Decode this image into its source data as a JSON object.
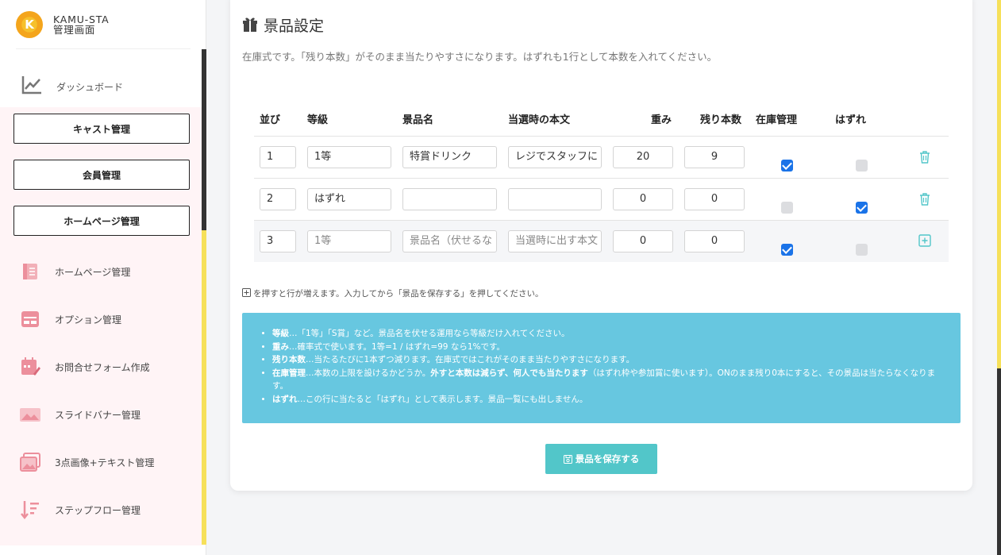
{
  "brand": {
    "line1": "KAMU-STA",
    "line2": "管理画面",
    "logo": "K"
  },
  "sidebar": {
    "dashboard": "ダッシュボード",
    "buttons": [
      "キャスト管理",
      "会員管理",
      "ホームページ管理"
    ],
    "sub_items": [
      {
        "label": "ホームページ管理",
        "icon": "book-icon"
      },
      {
        "label": "オプション管理",
        "icon": "option-list-icon"
      },
      {
        "label": "お問合せフォーム作成",
        "icon": "calendar-edit-icon"
      },
      {
        "label": "スライドバナー管理",
        "icon": "image-banner-icon"
      },
      {
        "label": "3点画像+テキスト管理",
        "icon": "images-icon"
      },
      {
        "label": "ステップフロー管理",
        "icon": "sort-flow-icon"
      }
    ]
  },
  "page": {
    "title": "景品設定",
    "description": "在庫式です。「残り本数」がそのまま当たりやすさになります。はずれも1行として本数を入れてください。"
  },
  "table": {
    "headers": [
      "並び",
      "等級",
      "景品名",
      "当選時の本文",
      "重み",
      "残り本数",
      "在庫管理",
      "はずれ"
    ],
    "rows": [
      {
        "order": "1",
        "grade": "1等",
        "name": "特賞ドリンク",
        "body": "レジでスタッフに",
        "weight": "20",
        "remaining": "9",
        "stock": true,
        "miss": false,
        "action": "trash"
      },
      {
        "order": "2",
        "grade": "はずれ",
        "name": "",
        "body": "",
        "weight": "0",
        "remaining": "0",
        "stock": false,
        "miss": true,
        "action": "trash"
      },
      {
        "order": "3",
        "grade": "1等",
        "name_placeholder": "景品名（伏せるな",
        "body_placeholder": "当選時に出す本文",
        "weight": "0",
        "remaining": "0",
        "stock": true,
        "miss": false,
        "action": "add"
      }
    ]
  },
  "hint": "を押すと行が増えます。入力してから「景品を保存する」を押してください。",
  "info": [
    {
      "key": "等級",
      "text": "…「1等」「S賞」など。景品名を伏せる運用なら等級だけ入れてください。"
    },
    {
      "key": "重み",
      "text": "…確率式で使います。1等=1 / はずれ=99 なら1%です。"
    },
    {
      "key": "残り本数",
      "text": "…当たるたびに1本ずつ減ります。在庫式ではこれがそのまま当たりやすさになります。"
    },
    {
      "key": "在庫管理",
      "text": "…本数の上限を設けるかどうか。",
      "bold2": "外すと本数は減らず、何人でも当たります",
      "text2": "（はずれ枠や参加賞に使います）。ONのまま残り0本にすると、その景品は当たらなくなります。"
    },
    {
      "key": "はずれ",
      "text": "…この行に当たると「はずれ」として表示します。景品一覧にも出しません。"
    }
  ],
  "save_label": "景品を保存する",
  "colors": {
    "accent": "#52c6c9",
    "info": "#67c7e0",
    "checkbox": "#1a73e8",
    "sidebar_bg": "#fff4f6",
    "strip_yellow": "#f6e05a"
  }
}
